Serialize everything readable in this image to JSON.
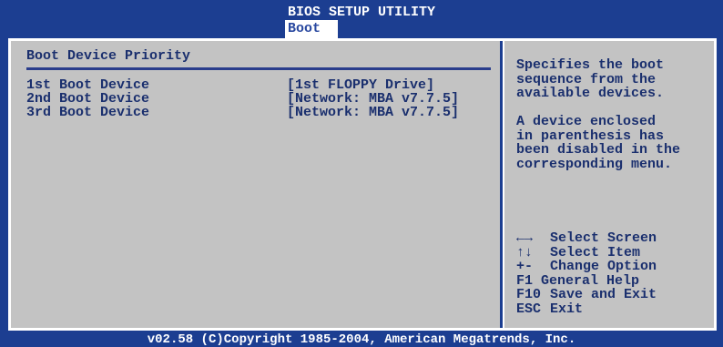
{
  "header": {
    "title": "BIOS SETUP UTILITY",
    "active_tab": "Boot"
  },
  "main": {
    "section_title": "Boot Device Priority",
    "boot_devices": [
      {
        "label": "1st Boot Device",
        "value": "[1st FLOPPY Drive]"
      },
      {
        "label": "2nd Boot Device",
        "value": "[Network: MBA v7.7.5]"
      },
      {
        "label": "3rd Boot Device",
        "value": "[Network: MBA v7.7.5]"
      }
    ]
  },
  "help": {
    "lines": [
      "Specifies the boot",
      "sequence from the",
      "available devices.",
      "",
      "A device enclosed",
      "in parenthesis has",
      "been disabled in the",
      "corresponding menu."
    ]
  },
  "keys": [
    {
      "key": "←→",
      "desc": "Select Screen",
      "icon": "left-right-arrows-icon"
    },
    {
      "key": "↑↓",
      "desc": "Select Item",
      "icon": "up-down-arrows-icon"
    },
    {
      "key": "+-",
      "desc": "Change Option"
    },
    {
      "key": "F1",
      "desc": "General Help"
    },
    {
      "key": "F10",
      "desc": "Save and Exit"
    },
    {
      "key": "ESC",
      "desc": "Exit"
    }
  ],
  "footer": {
    "text": "v02.58 (C)Copyright 1985-2004, American Megatrends, Inc."
  },
  "colors": {
    "background": "#1c3e91",
    "panel": "#c3c3c3",
    "text": "#1a2f6e",
    "header_text": "#ffffff"
  }
}
